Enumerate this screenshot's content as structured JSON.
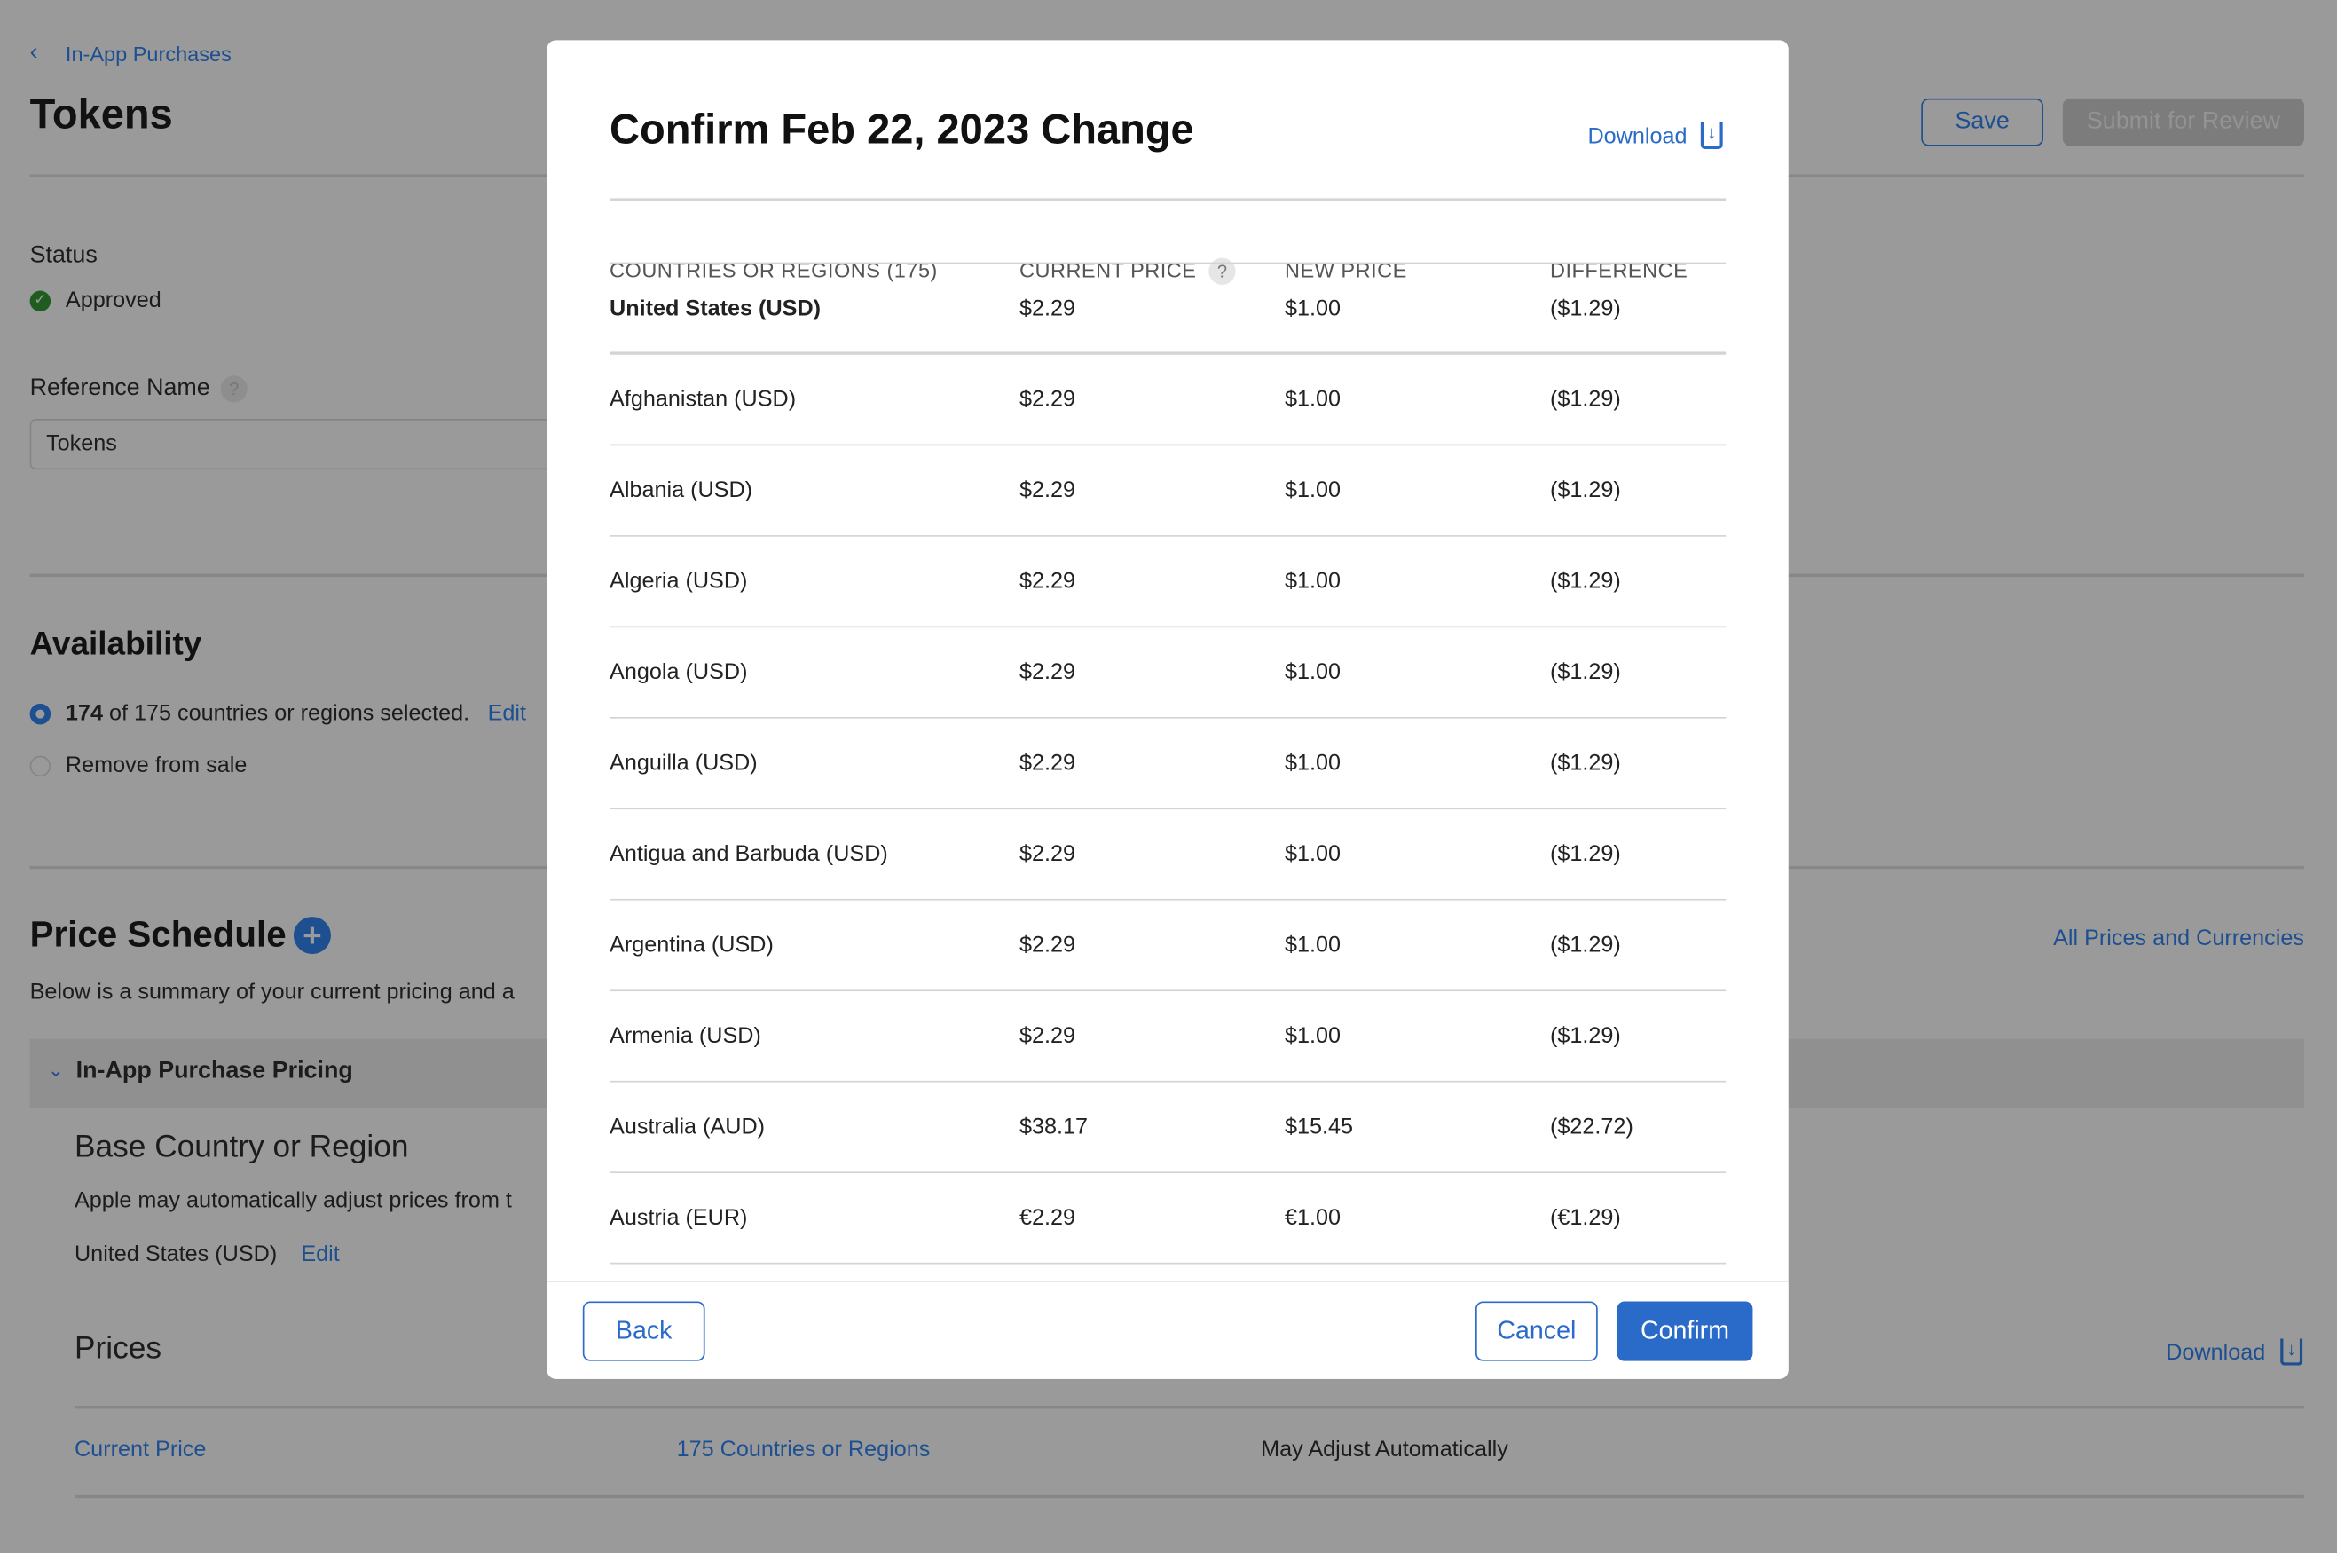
{
  "page": {
    "breadcrumb": "In-App Purchases",
    "title": "Tokens",
    "save_label": "Save",
    "submit_label": "Submit for Review",
    "status_label": "Status",
    "status_value": "Approved",
    "reference_name_label": "Reference Name",
    "reference_name_value": "Tokens",
    "availability_title": "Availability",
    "availability_count": "174",
    "availability_text": "of 175 countries or regions selected.",
    "availability_edit": "Edit",
    "remove_from_sale": "Remove from sale",
    "price_schedule_title": "Price Schedule",
    "all_prices_link": "All Prices and Currencies",
    "price_schedule_desc": "Below is a summary of your current pricing and a",
    "pricing_section": "In-App Purchase Pricing",
    "base_country_title": "Base Country or Region",
    "base_country_desc": "Apple may automatically adjust prices from t",
    "base_country_value": "United States (USD)",
    "base_country_edit": "Edit",
    "prices_title": "Prices",
    "prices_download": "Download",
    "prices_row": {
      "col1": "Current Price",
      "col2": "175 Countries or Regions",
      "col3": "May Adjust Automatically"
    }
  },
  "modal": {
    "title": "Confirm Feb 22, 2023 Change",
    "download": "Download",
    "columns": [
      "COUNTRIES OR REGIONS (175)",
      "CURRENT PRICE",
      "NEW PRICE",
      "DIFFERENCE"
    ],
    "rows": [
      [
        "United States (USD)",
        "$2.29",
        "$1.00",
        "($1.29)"
      ],
      [
        "Afghanistan (USD)",
        "$2.29",
        "$1.00",
        "($1.29)"
      ],
      [
        "Albania (USD)",
        "$2.29",
        "$1.00",
        "($1.29)"
      ],
      [
        "Algeria (USD)",
        "$2.29",
        "$1.00",
        "($1.29)"
      ],
      [
        "Angola (USD)",
        "$2.29",
        "$1.00",
        "($1.29)"
      ],
      [
        "Anguilla (USD)",
        "$2.29",
        "$1.00",
        "($1.29)"
      ],
      [
        "Antigua and Barbuda (USD)",
        "$2.29",
        "$1.00",
        "($1.29)"
      ],
      [
        "Argentina (USD)",
        "$2.29",
        "$1.00",
        "($1.29)"
      ],
      [
        "Armenia (USD)",
        "$2.29",
        "$1.00",
        "($1.29)"
      ],
      [
        "Australia (AUD)",
        "$38.17",
        "$15.45",
        "($22.72)"
      ],
      [
        "Austria (EUR)",
        "€2.29",
        "€1.00",
        "(€1.29)"
      ]
    ],
    "back": "Back",
    "cancel": "Cancel",
    "confirm": "Confirm"
  },
  "colors": {
    "accent": "#2a6bc9",
    "overlay": "#9a9a9a",
    "approved": "#1f5c1f"
  }
}
